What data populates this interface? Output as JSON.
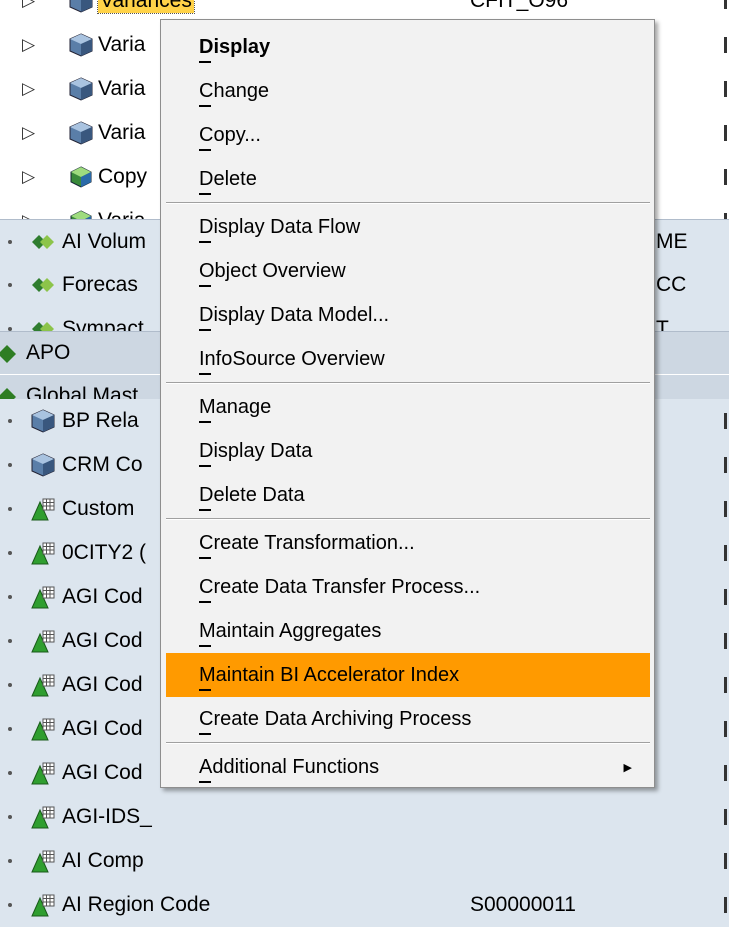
{
  "tree": {
    "rows": [
      {
        "label": "Variances",
        "col2": "CFIT_O96",
        "icon": "cube-icon",
        "level": 2,
        "caret": true,
        "selected": true
      },
      {
        "label": "Varia",
        "icon": "cube-icon",
        "level": 2,
        "caret": true
      },
      {
        "label": "Varia",
        "icon": "cube-icon",
        "level": 2,
        "caret": true
      },
      {
        "label": "Varia",
        "icon": "cube-icon",
        "level": 2,
        "caret": true
      },
      {
        "label": "Copy",
        "icon": "multiprovider-icon",
        "level": 2,
        "caret": true
      },
      {
        "label": "Varia",
        "icon": "multiprovider-icon",
        "level": 2,
        "caret": true
      },
      {
        "label": "AI Volum",
        "col3": "ME",
        "icon": "infoarea-icon",
        "level": 1
      },
      {
        "label": "Forecas",
        "col3": "CC",
        "icon": "infoarea-icon",
        "level": 1
      },
      {
        "label": "Sympact",
        "col3": "T",
        "icon": "infoarea-icon",
        "level": 1
      },
      {
        "label": "APO",
        "icon": "folder-diamond-icon",
        "level": 0
      },
      {
        "label": "Global Mast",
        "icon": "folder-diamond-icon",
        "level": 0
      },
      {
        "label": "BP Rela",
        "icon": "cube-icon",
        "level": 1
      },
      {
        "label": "CRM Co",
        "icon": "cube-icon",
        "level": 1
      },
      {
        "label": "Custom",
        "icon": "characteristic-icon",
        "level": 1
      },
      {
        "label": "0CITY2 (",
        "icon": "characteristic-icon",
        "level": 1
      },
      {
        "label": "AGI Cod",
        "icon": "characteristic-icon",
        "level": 1
      },
      {
        "label": "AGI Cod",
        "icon": "characteristic-icon",
        "level": 1
      },
      {
        "label": "AGI Cod",
        "icon": "characteristic-icon",
        "level": 1
      },
      {
        "label": "AGI Cod",
        "icon": "characteristic-icon",
        "level": 1
      },
      {
        "label": "AGI Cod",
        "icon": "characteristic-icon",
        "level": 1
      },
      {
        "label": "AGI-IDS_",
        "icon": "characteristic-icon",
        "level": 1
      },
      {
        "label": "AI Comp",
        "icon": "characteristic-icon",
        "level": 1
      },
      {
        "label": "AI Region Code",
        "col2": "S00000011",
        "icon": "characteristic-icon",
        "level": 1
      }
    ]
  },
  "context_menu": {
    "items": [
      {
        "label": "Display",
        "bold": true
      },
      {
        "label": "Change"
      },
      {
        "label": "Copy..."
      },
      {
        "label": "Delete",
        "separator_after": true
      },
      {
        "label": "Display Data Flow"
      },
      {
        "label": "Object Overview"
      },
      {
        "label": "Display Data Model..."
      },
      {
        "label": "InfoSource Overview",
        "separator_after": true
      },
      {
        "label": "Manage"
      },
      {
        "label": "Display Data"
      },
      {
        "label": "Delete Data",
        "separator_after": true
      },
      {
        "label": "Create Transformation..."
      },
      {
        "label": "Create Data Transfer Process..."
      },
      {
        "label": "Maintain Aggregates"
      },
      {
        "label": "Maintain BI Accelerator Index",
        "highlighted": true
      },
      {
        "label": "Create Data Archiving Process",
        "separator_after": true
      },
      {
        "label": "Additional Functions",
        "submenu": true
      }
    ]
  },
  "colors": {
    "highlight": "#ff9a00",
    "selection": "#ffd248",
    "row_alt": "#dce5ee",
    "menu_bg": "#f2f2f2"
  }
}
